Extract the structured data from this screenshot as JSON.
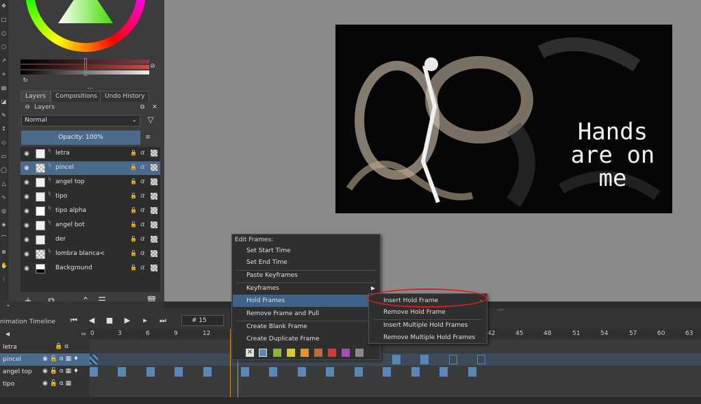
{
  "dock": {
    "tabs": [
      "Layers",
      "Compositions",
      "Undo History"
    ],
    "layers_title": "Layers",
    "blend_mode": "Normal",
    "opacity": "Opacity:  100%",
    "layers": [
      {
        "name": "letra",
        "locked": true,
        "selected": false
      },
      {
        "name": "pincel",
        "locked": false,
        "selected": true
      },
      {
        "name": "angel top",
        "locked": false,
        "selected": false
      },
      {
        "name": "tipo",
        "locked": false,
        "selected": false
      },
      {
        "name": "tipo alpha",
        "locked": false,
        "selected": false
      },
      {
        "name": "angel bot",
        "locked": false,
        "selected": false
      },
      {
        "name": "der",
        "locked": false,
        "selected": false
      },
      {
        "name": "lombra blanca<",
        "locked": false,
        "selected": false
      },
      {
        "name": "Background",
        "locked": false,
        "selected": false
      }
    ]
  },
  "canvas": {
    "art_text": "Hands are on me"
  },
  "timeline": {
    "title": "nimation Timeline",
    "frame_prefix": "#",
    "current_frame": "15",
    "ruler_ticks": [
      "0",
      "3",
      "6",
      "9",
      "12",
      "42",
      "45",
      "48",
      "51",
      "54",
      "57",
      "60",
      "63"
    ],
    "tracks": [
      "letra",
      "pincel",
      "angel top",
      "tipo"
    ]
  },
  "menu": {
    "title": "Edit Frames:",
    "items": {
      "set_start": "Set Start Time",
      "set_end": "Set End Time",
      "paste_kf": "Paste Keyframes",
      "keyframes": "Keyframes",
      "hold_frames": "Hold Frames",
      "remove_pull": "Remove Frame and Pull",
      "create_blank": "Create Blank Frame",
      "create_dup": "Create Duplicate Frame"
    },
    "remove_pull_shortcut": "_",
    "swatch_colors": [
      "#5a88b6",
      "#8ab43a",
      "#d6c92d",
      "#e2932a",
      "#b86e3a",
      "#d03a3a",
      "#a24fb8",
      "#8a8a8a"
    ]
  },
  "submenu": {
    "insert_hold": "Insert Hold Frame",
    "insert_hold_shortcut": "-",
    "remove_hold": "Remove Hold Frame",
    "insert_multi": "Insert Multiple Hold Frames",
    "remove_multi": "Remove Multiple Hold Frames"
  },
  "colors": {
    "selection": "#4a6b8c",
    "menu_highlight": "#3f6288",
    "annotation": "#d81e1e",
    "playhead": "#d4982e"
  }
}
